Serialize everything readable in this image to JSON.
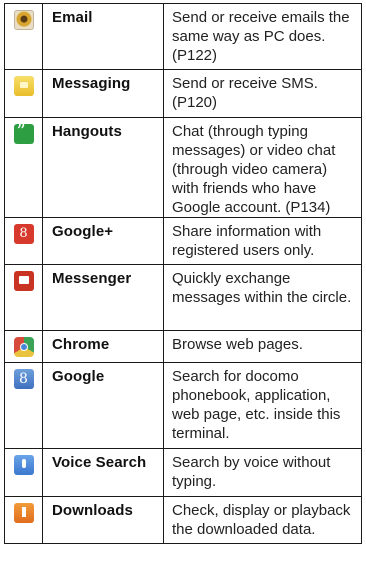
{
  "rows": [
    {
      "icon": "email-icon",
      "name": "Email",
      "desc": "Send or receive emails the same way as PC does. (P122)"
    },
    {
      "icon": "messaging-icon",
      "name": "Messaging",
      "desc": "Send or receive SMS. (P120)"
    },
    {
      "icon": "hangouts-icon",
      "name": "Hangouts",
      "desc": "Chat (through typing messages) or video chat (through video camera) with friends who have Google account. (P134)"
    },
    {
      "icon": "google-plus-icon",
      "name": "Google+",
      "desc": "Share information with registered users only."
    },
    {
      "icon": "messenger-icon",
      "name": "Messenger",
      "desc": "Quickly exchange messages within the circle."
    },
    {
      "icon": "chrome-icon",
      "name": "Chrome",
      "desc": "Browse web pages."
    },
    {
      "icon": "google-search-icon",
      "name": "Google",
      "desc": "Search for docomo phonebook, application, web page, etc. inside this terminal."
    },
    {
      "icon": "voice-search-icon",
      "name": "Voice Search",
      "desc": "Search by voice without typing."
    },
    {
      "icon": "downloads-icon",
      "name": "Downloads",
      "desc": "Check, display or playback the downloaded data."
    }
  ]
}
